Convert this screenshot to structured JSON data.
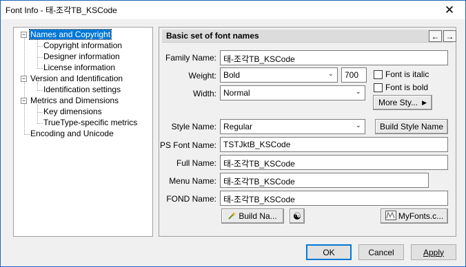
{
  "window": {
    "title": "Font Info - 태-조각TB_KSCode",
    "close_glyph": "✕"
  },
  "tree": {
    "items": [
      {
        "label": "Names and Copyright",
        "expander": "−"
      },
      {
        "label": "Copyright information"
      },
      {
        "label": "Designer information"
      },
      {
        "label": "License information"
      },
      {
        "label": "Version and Identification",
        "expander": "−"
      },
      {
        "label": "Identification settings"
      },
      {
        "label": "Metrics and Dimensions",
        "expander": "−"
      },
      {
        "label": "Key dimensions"
      },
      {
        "label": "TrueType-specific metrics"
      },
      {
        "label": "Encoding and Unicode"
      }
    ]
  },
  "panel": {
    "title": "Basic set of font names",
    "prev_glyph": "🡐",
    "next_glyph": "🡒",
    "family_name_label": "Family Name:",
    "family_name_value": "태-조각TB_KSCode",
    "weight_label": "Weight:",
    "weight_value": "Bold",
    "weight_number": "700",
    "width_label": "Width:",
    "width_value": "Normal",
    "font_is_italic": "Font is italic",
    "font_is_bold": "Font is bold",
    "more_styles_button": "More Sty...",
    "style_name_label": "Style Name:",
    "style_name_value": "Regular",
    "build_style_name_button": "Build Style Name",
    "ps_font_name_label": "PS Font Name:",
    "ps_font_name_value": "TSTJktB_KSCode",
    "full_name_label": "Full Name:",
    "full_name_value": "태-조각TB_KSCode",
    "menu_name_label": "Menu Name:",
    "menu_name_value": "태-조각TB_KSCode",
    "fond_name_label": "FOND Name:",
    "fond_name_value": "태-조각TB_KSCode",
    "build_names_button": "Build Na...",
    "myfonts_button": "MyFonts.c..."
  },
  "footer": {
    "ok": "OK",
    "cancel": "Cancel",
    "apply": "Apply"
  },
  "colors": {
    "selection": "#0078d7",
    "window_border": "#1a63b8"
  }
}
